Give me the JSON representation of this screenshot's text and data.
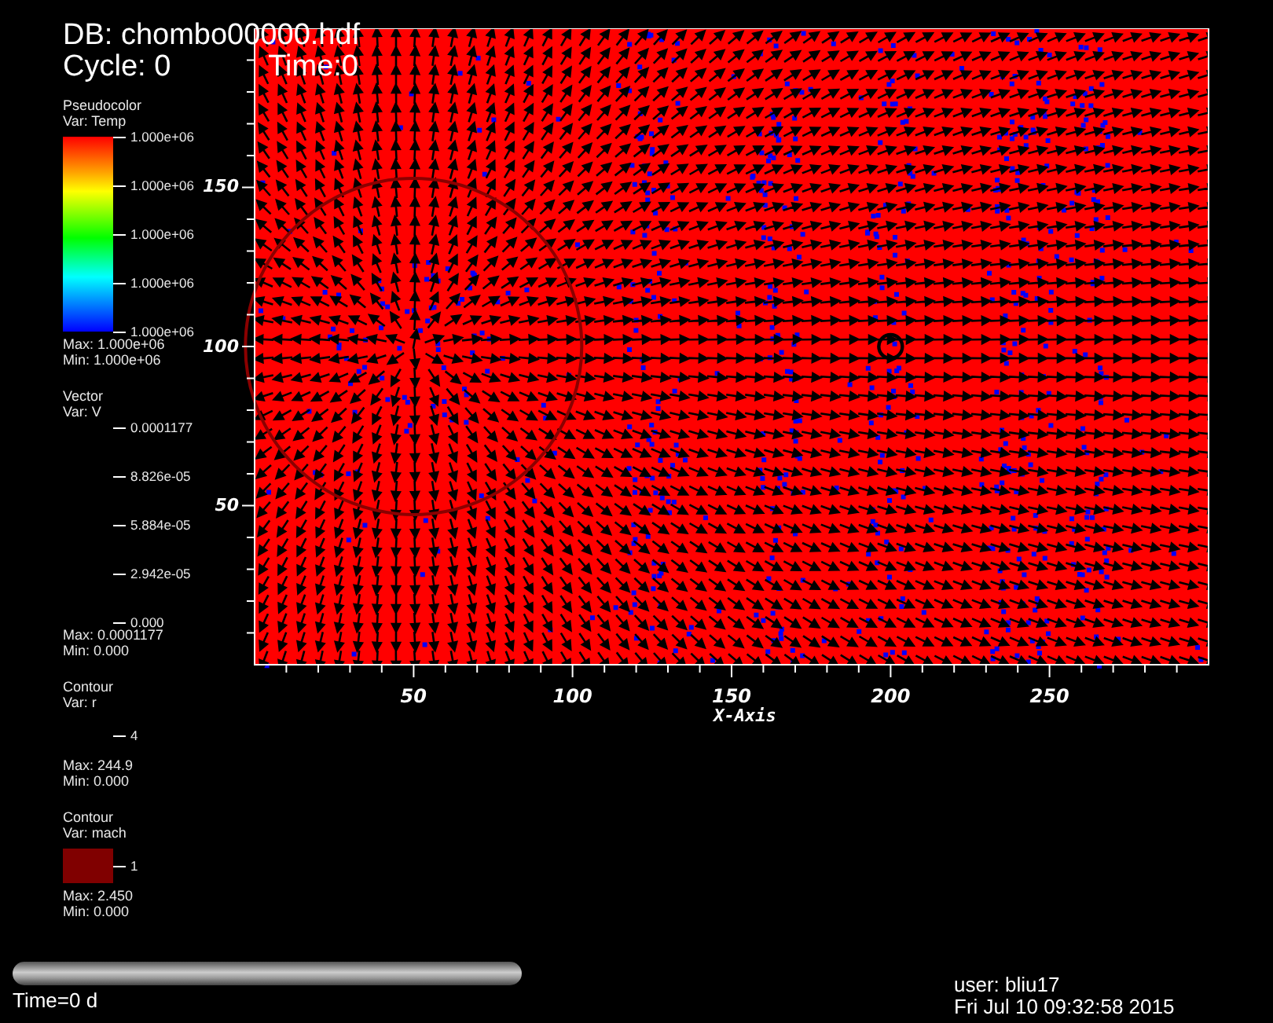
{
  "header": {
    "database": "DB: chombo00000.hdf",
    "cycle": "Cycle: 0",
    "time": "Time:0"
  },
  "legends": [
    {
      "kind": "colorbar",
      "plot": "Pseudocolor",
      "var": "Var: Temp",
      "ticks": [
        "1.000e+06",
        "1.000e+06",
        "1.000e+06",
        "1.000e+06",
        "1.000e+06"
      ],
      "max": "Max:  1.000e+06",
      "min": "Min:  1.000e+06"
    },
    {
      "kind": "ticks",
      "plot": "Vector",
      "var": "Var: V",
      "ticks": [
        "0.0001177",
        "8.826e-05",
        "5.884e-05",
        "2.942e-05",
        "0.000"
      ],
      "max": "Max:  0.0001177",
      "min": "Min:  0.000"
    },
    {
      "kind": "ticks",
      "plot": "Contour",
      "var": "Var: r",
      "ticks": [
        "4"
      ],
      "max": "Max:  244.9",
      "min": "Min:  0.000"
    },
    {
      "kind": "swatch",
      "plot": "Contour",
      "var": "Var: mach",
      "ticks": [
        "1"
      ],
      "color": "#800000",
      "max": "Max:  2.450",
      "min": "Min:  0.000"
    }
  ],
  "plot": {
    "x_ticks": [
      "50",
      "100",
      "150",
      "200",
      "250"
    ],
    "y_ticks": [
      "150",
      "100",
      "50"
    ],
    "xlabel": "X-Axis"
  },
  "time_slider": {
    "label": "Time=0 d"
  },
  "user_info": {
    "user": "user: bliu17",
    "date": "Fri Jul 10 09:32:58 2015"
  }
}
